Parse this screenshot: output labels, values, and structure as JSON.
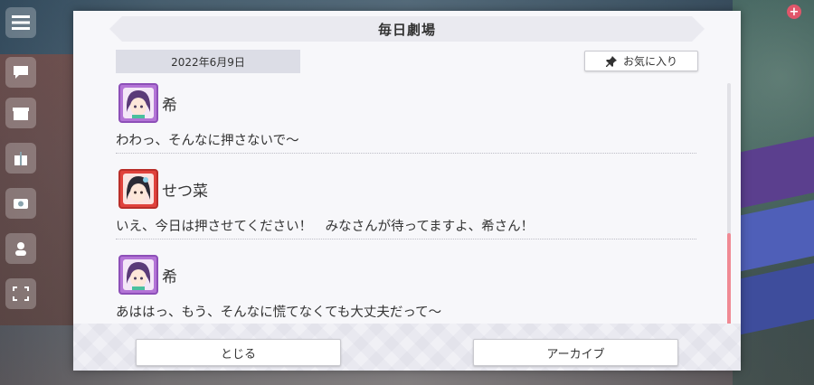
{
  "dialog": {
    "title": "毎日劇場",
    "date": "2022年6月9日",
    "favorite_label": "お気に入り",
    "close_label": "とじる",
    "archive_label": "アーカイブ"
  },
  "entries": [
    {
      "speaker": "希",
      "text": "わわっ、そんなに押さないで～",
      "avatar_color": "#b374d6"
    },
    {
      "speaker": "せつ菜",
      "text": "いえ、今日は押させてください！　みなさんが待ってますよ、希さん！",
      "avatar_color": "#e0423c"
    },
    {
      "speaker": "希",
      "text": "あははっ、もう、そんなに慌てなくても大丈夫だって～",
      "avatar_color": "#b374d6"
    }
  ],
  "scrollbar": {
    "thumb_start_fraction": 0.6,
    "thumb_size_fraction": 0.4
  },
  "colors": {
    "accent_pink": "#f08a94",
    "badge": "#e0566a"
  },
  "icons": {
    "menu": "menu-icon",
    "pin": "pin-icon",
    "plus": "plus-icon"
  }
}
